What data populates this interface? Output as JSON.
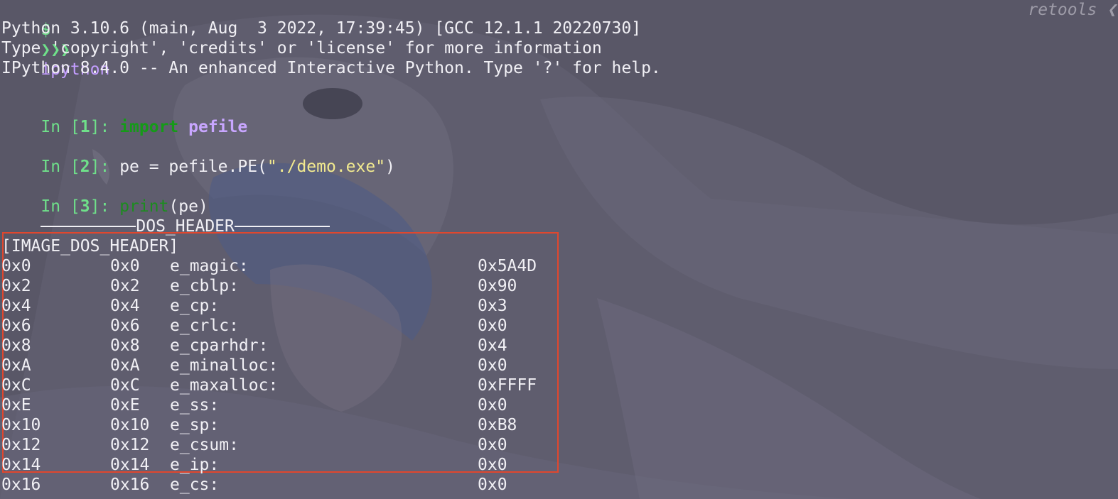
{
  "prompt": {
    "dollar": "$",
    "arrows": "❯❯❯",
    "command": "ipython",
    "right_label": "retools ❮"
  },
  "banner": [
    "Python 3.10.6 (main, Aug  3 2022, 17:39:45) [GCC 12.1.1 20220730]",
    "Type 'copyright', 'credits' or 'license' for more information",
    "IPython 8.4.0 -- An enhanced Interactive Python. Type '?' for help."
  ],
  "cells": [
    {
      "prompt_in": "In [",
      "num": "1",
      "prompt_close": "]: ",
      "kw": "import",
      "space": " ",
      "module": "pefile"
    },
    {
      "prompt_in": "In [",
      "num": "2",
      "prompt_close": "]: ",
      "code_a": "pe = pefile.PE(",
      "string": "\"./demo.exe\"",
      "code_b": ")"
    },
    {
      "prompt_in": "In [",
      "num": "3",
      "prompt_close": "]: ",
      "builtin": "print",
      "code": "(pe)"
    }
  ],
  "section_title": "DOS_HEADER",
  "struct_name": "[IMAGE_DOS_HEADER]",
  "fields": [
    {
      "file_off": "0x0",
      "off": "0x0",
      "name": "e_magic:",
      "value": "0x5A4D"
    },
    {
      "file_off": "0x2",
      "off": "0x2",
      "name": "e_cblp:",
      "value": "0x90"
    },
    {
      "file_off": "0x4",
      "off": "0x4",
      "name": "e_cp:",
      "value": "0x3"
    },
    {
      "file_off": "0x6",
      "off": "0x6",
      "name": "e_crlc:",
      "value": "0x0"
    },
    {
      "file_off": "0x8",
      "off": "0x8",
      "name": "e_cparhdr:",
      "value": "0x4"
    },
    {
      "file_off": "0xA",
      "off": "0xA",
      "name": "e_minalloc:",
      "value": "0x0"
    },
    {
      "file_off": "0xC",
      "off": "0xC",
      "name": "e_maxalloc:",
      "value": "0xFFFF"
    },
    {
      "file_off": "0xE",
      "off": "0xE",
      "name": "e_ss:",
      "value": "0x0"
    },
    {
      "file_off": "0x10",
      "off": "0x10",
      "name": "e_sp:",
      "value": "0xB8"
    },
    {
      "file_off": "0x12",
      "off": "0x12",
      "name": "e_csum:",
      "value": "0x0"
    },
    {
      "file_off": "0x14",
      "off": "0x14",
      "name": "e_ip:",
      "value": "0x0"
    },
    {
      "file_off": "0x16",
      "off": "0x16",
      "name": "e_cs:",
      "value": "0x0"
    }
  ],
  "colors": {
    "background": "#5a5867",
    "text": "#f1f0f5",
    "prompt_green": "#6fe08a",
    "keyword_green": "#159a18",
    "module_purple": "#c8a6ff",
    "string_yellow": "#f1e98f",
    "highlight_border": "#e0472e"
  }
}
